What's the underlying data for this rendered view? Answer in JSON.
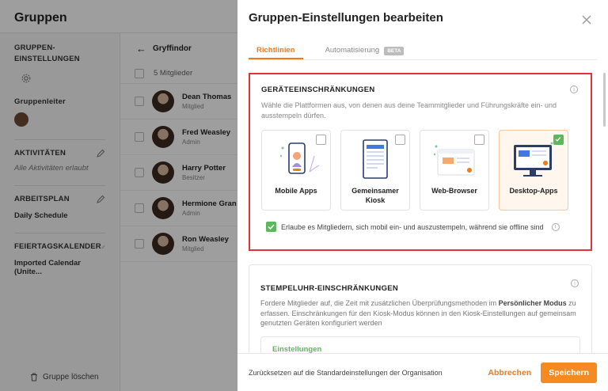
{
  "app": {
    "title": "Gruppen",
    "sidebar": {
      "settings_heading": "GRUPPEN-\nEINSTELLUNGEN",
      "leader_label": "Gruppenleiter",
      "activities_heading": "AKTIVITÄTEN",
      "activities_value": "Alle Aktivitäten erlaubt",
      "schedule_heading": "ARBEITSPLAN",
      "schedule_value": "Daily Schedule",
      "holiday_heading": "FEIERTAGSKALENDER",
      "holiday_value": "Imported Calendar (Unite...",
      "delete_label": "Gruppe löschen"
    },
    "members": {
      "group_name": "Gryffindor",
      "count_label": "5 Mitglieder",
      "rows": [
        {
          "name": "Dean Thomas",
          "role": "Mitglied"
        },
        {
          "name": "Fred Weasley",
          "role": "Admin"
        },
        {
          "name": "Harry Potter",
          "role": "Besitzer"
        },
        {
          "name": "Hermione Gran",
          "role": "Admin"
        },
        {
          "name": "Ron Weasley",
          "role": "Mitglied"
        }
      ]
    }
  },
  "panel": {
    "title": "Gruppen-Einstellungen bearbeiten",
    "tabs": [
      {
        "label": "Richtlinien",
        "active": true
      },
      {
        "label": "Automatisierung",
        "badge": "BETA"
      }
    ],
    "device_card": {
      "title": "GERÄTEEINSCHRÄNKUNGEN",
      "description": "Wähle die Plattformen aus, von denen aus deine Teammitglieder und Führungskräfte ein- und ausstempeln dürfen.",
      "tiles": [
        {
          "label": "Mobile Apps",
          "checked": false
        },
        {
          "label": "Gemeinsamer Kiosk",
          "checked": false
        },
        {
          "label": "Web-Browser",
          "checked": false
        },
        {
          "label": "Desktop-Apps",
          "checked": true
        }
      ],
      "offline_label": "Erlaube es Mitgliedern, sich mobil ein- und auszustempeln, während sie offline sind"
    },
    "clock_card": {
      "title": "STEMPELUHR-EINSCHRÄNKUNGEN",
      "description_pre": "Fordere Mitglieder auf, die Zeit mit zusätzlichen Überprüfungsmethoden im ",
      "description_bold": "Persönlicher Modus",
      "description_post": " zu erfassen. Einschränkungen für den Kiosk-Modus können in den Kiosk-Einstellungen auf gemeinsam genutzten Geräten konfiguriert werden",
      "inner_label": "Einstellungen"
    },
    "footer": {
      "reset_label": "Zurücksetzen auf die Standardeinstellungen der Organisation",
      "cancel_label": "Abbrechen",
      "save_label": "Speichern"
    },
    "colors": {
      "accent": "#f07a1a",
      "highlight": "#e2323b",
      "check": "#5cb85c"
    }
  }
}
